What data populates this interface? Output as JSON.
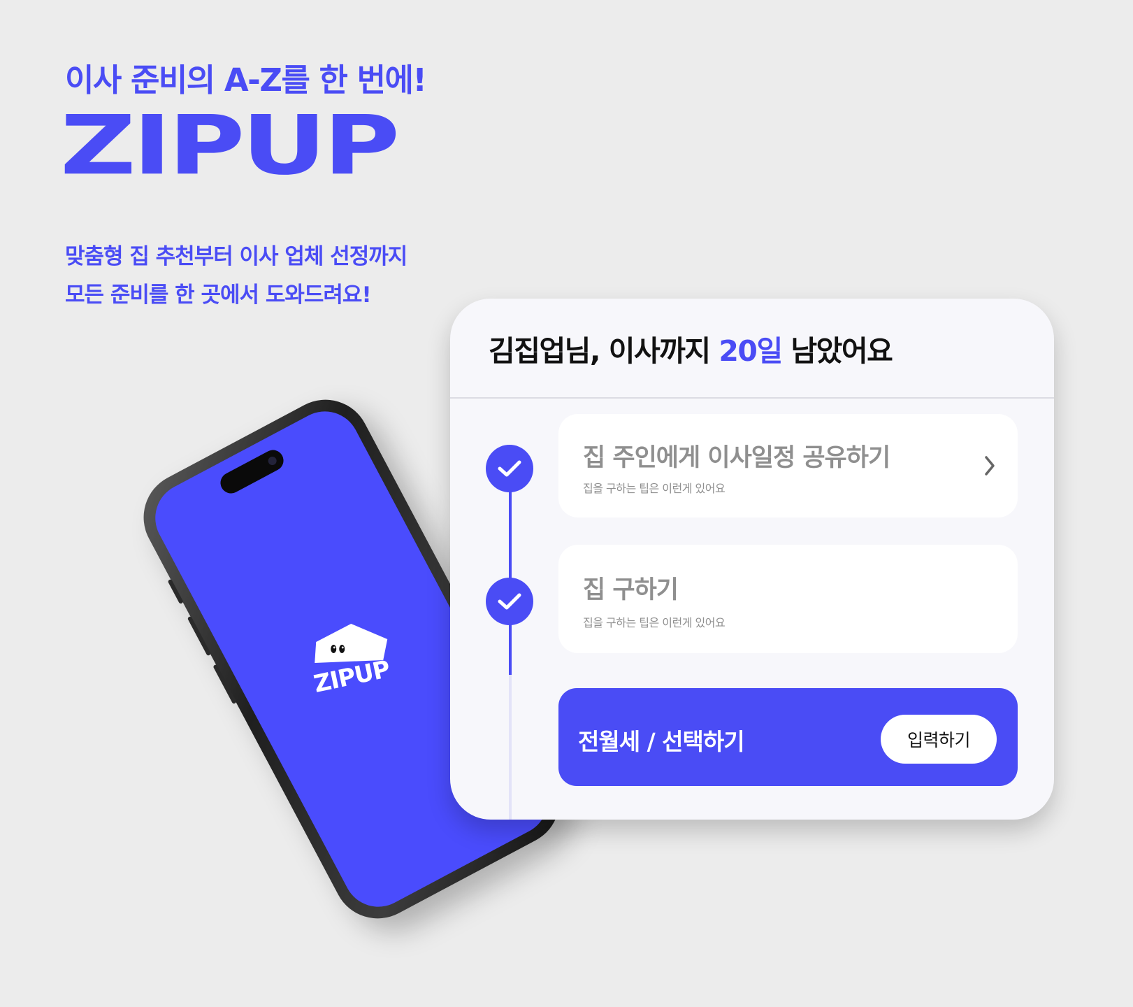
{
  "hero": {
    "tagline": "이사 준비의 A-Z를 한 번에!",
    "brand": "ZIPUP",
    "subcopy_line1": "맞춤형 집 추천부터 이사 업체 선정까지",
    "subcopy_line2": "모든 준비를 한 곳에서 도와드려요!"
  },
  "phone": {
    "app_logo_text": "ZIPUP",
    "app_logo_icon": "house-with-eyes-icon"
  },
  "card": {
    "greeting_prefix": "김집업님, 이사까지 ",
    "days_left": "20일",
    "greeting_suffix": " 남았어요",
    "steps": [
      {
        "title": "집 주인에게 이사일정 공유하기",
        "description": "집을 구하는 팁은 이런게 있어요",
        "completed": true,
        "icon": "chevron-right-icon"
      },
      {
        "title": "집 구하기",
        "description": "집을 구하는 팁은 이런게 있어요",
        "completed": true
      }
    ],
    "cta": {
      "label": "전월세 / 선택하기",
      "button_label": "입력하기"
    }
  },
  "colors": {
    "accent": "#4a4cf5",
    "background": "#ececec",
    "card_background": "#f7f7fb",
    "muted_text": "#8f8f8f"
  }
}
